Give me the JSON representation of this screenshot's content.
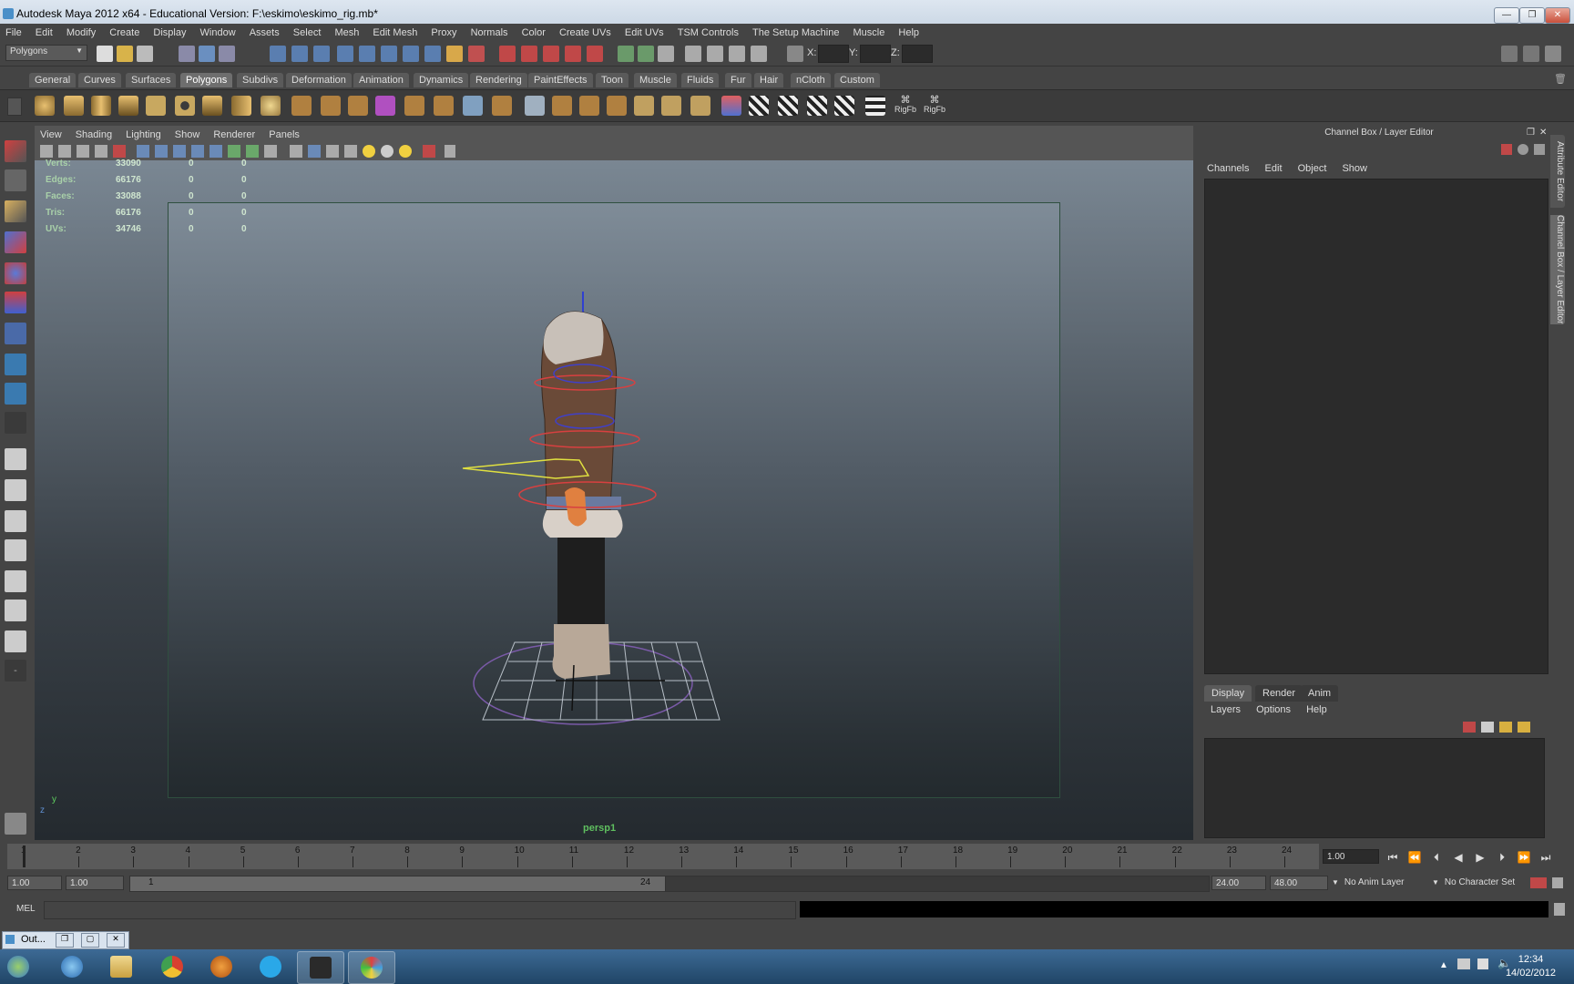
{
  "window": {
    "title": "Autodesk Maya 2012 x64 - Educational Version: F:\\eskimo\\eskimo_rig.mb*",
    "minimize": "—",
    "maximize": "❐",
    "close": "✕"
  },
  "menubar": [
    "File",
    "Edit",
    "Modify",
    "Create",
    "Display",
    "Window",
    "Assets",
    "Select",
    "Mesh",
    "Edit Mesh",
    "Proxy",
    "Normals",
    "Color",
    "Create UVs",
    "Edit UVs",
    "TSM Controls",
    "The Setup Machine",
    "Muscle",
    "Help"
  ],
  "statusline": {
    "menu_set": "Polygons",
    "x_label": "X:",
    "y_label": "Y:",
    "z_label": "Z:"
  },
  "shelf": {
    "tabs": [
      "General",
      "Curves",
      "Surfaces",
      "Polygons",
      "Subdivs",
      "Deformation",
      "Animation",
      "Dynamics",
      "Rendering",
      "PaintEffects",
      "Toon",
      "Muscle",
      "Fluids",
      "Fur",
      "Hair",
      "nCloth",
      "Custom"
    ],
    "selected": "Polygons",
    "rig_label_1": "RigFb",
    "rig_label_2": "RigFb"
  },
  "viewport": {
    "menu": [
      "View",
      "Shading",
      "Lighting",
      "Show",
      "Renderer",
      "Panels"
    ],
    "camera": "persp1",
    "hud": [
      {
        "label": "Verts:",
        "v1": "33090",
        "v2": "0",
        "v3": "0"
      },
      {
        "label": "Edges:",
        "v1": "66176",
        "v2": "0",
        "v3": "0"
      },
      {
        "label": "Faces:",
        "v1": "33088",
        "v2": "0",
        "v3": "0"
      },
      {
        "label": "Tris:",
        "v1": "66176",
        "v2": "0",
        "v3": "0"
      },
      {
        "label": "UVs:",
        "v1": "34746",
        "v2": "0",
        "v3": "0"
      }
    ],
    "axis_y": "y",
    "axis_z": "z"
  },
  "channelbox": {
    "title": "Channel Box / Layer Editor",
    "menu": [
      "Channels",
      "Edit",
      "Object",
      "Show"
    ],
    "layer_tabs": [
      "Display",
      "Render",
      "Anim"
    ],
    "layer_menu": [
      "Layers",
      "Options",
      "Help"
    ],
    "side_tab_1": "Attribute Editor",
    "side_tab_2": "Channel Box / Layer Editor"
  },
  "timeslider": {
    "ticks": [
      "1",
      "2",
      "3",
      "4",
      "5",
      "6",
      "7",
      "8",
      "9",
      "10",
      "11",
      "12",
      "13",
      "14",
      "15",
      "16",
      "17",
      "18",
      "19",
      "20",
      "21",
      "22",
      "23",
      "24"
    ],
    "current_time": "1.00"
  },
  "range": {
    "start": "1.00",
    "playback_start": "1.00",
    "range_start": "1",
    "range_end": "24",
    "playback_end": "24.00",
    "end": "48.00",
    "anim_layer": "No Anim Layer",
    "character_set": "No Character Set"
  },
  "cmdline": {
    "label": "MEL"
  },
  "minimized": {
    "label": "Out..."
  },
  "taskbar": {
    "time": "12:34",
    "date": "14/02/2012"
  },
  "colors": {
    "accent": "#6e6e6e",
    "hud_green": "#5fbf5f",
    "taskbar": "#2a5379"
  }
}
